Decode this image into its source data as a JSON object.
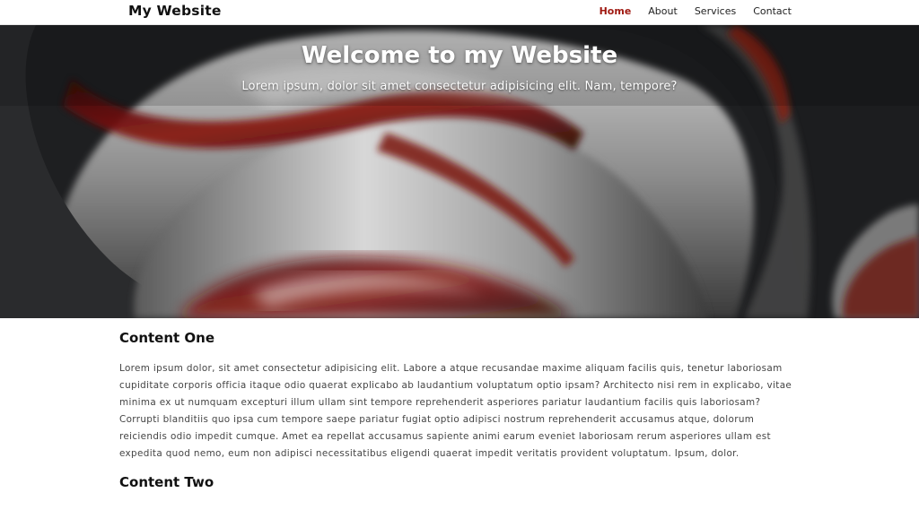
{
  "nav": {
    "brand": "My Website",
    "links": [
      {
        "label": "Home",
        "active": true
      },
      {
        "label": "About",
        "active": false
      },
      {
        "label": "Services",
        "active": false
      },
      {
        "label": "Contact",
        "active": false
      }
    ]
  },
  "hero": {
    "title": "Welcome to my Website",
    "subtitle": "Lorem ipsum, dolor sit amet consectetur adipisicing elit. Nam, tempore?"
  },
  "sections": [
    {
      "title": "Content One",
      "text": "Lorem ipsum dolor, sit amet consectetur adipisicing elit. Labore a atque recusandae maxime aliquam facilis quis, tenetur laboriosam cupiditate corporis officia itaque odio quaerat explicabo ab laudantium voluptatum optio ipsam? Architecto nisi rem in explicabo, vitae minima ex ut numquam excepturi illum ullam sint tempore reprehenderit asperiores pariatur laudantium facilis quis laboriosam? Corrupti blanditiis quo ipsa cum tempore saepe pariatur fugiat optio adipisci nostrum reprehenderit accusamus atque, dolorum reiciendis odio impedit cumque. Amet ea repellat accusamus sapiente animi earum eveniet laboriosam rerum asperiores ullam est expedita quod nemo, eum non adipisci necessitatibus eligendi quaerat impedit veritatis provident voluptatum. Ipsum, dolor."
    },
    {
      "title": "Content Two"
    }
  ],
  "colors": {
    "accent": "#a01a12",
    "hero_dark": "#1e1f21"
  }
}
